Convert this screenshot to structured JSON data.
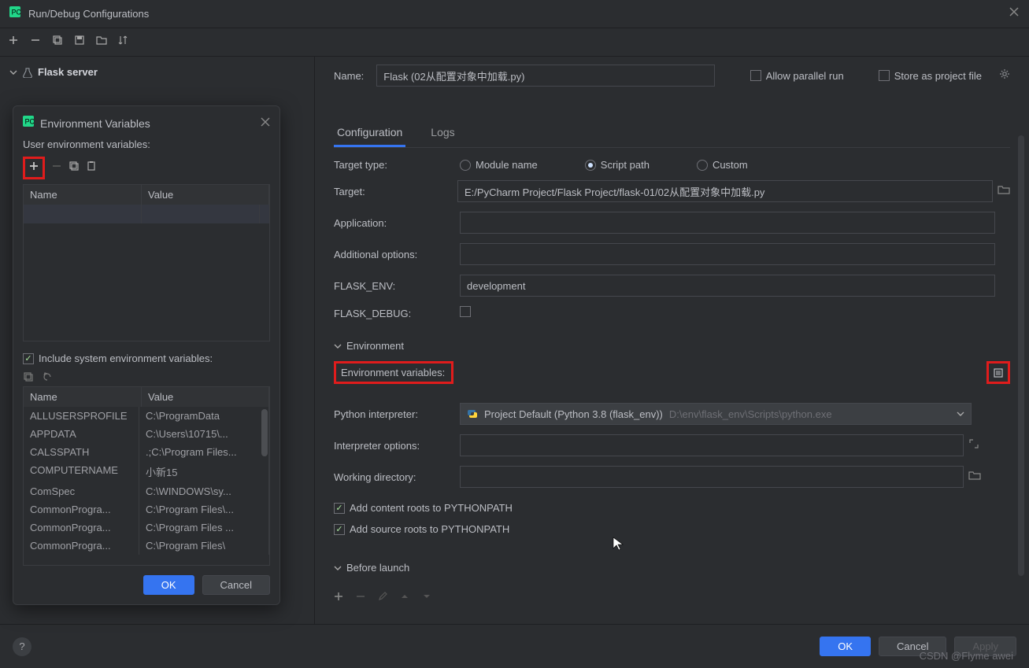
{
  "window": {
    "title": "Run/Debug Configurations"
  },
  "tree": {
    "rootLabel": "Flask server"
  },
  "name": {
    "label": "Name:",
    "value": "Flask (02从配置对象中加载.py)",
    "allowParallel": "Allow parallel run",
    "storeProject": "Store as project file"
  },
  "tabs": {
    "configuration": "Configuration",
    "logs": "Logs"
  },
  "targetType": {
    "label": "Target type:",
    "module": "Module name",
    "script": "Script path",
    "custom": "Custom"
  },
  "target": {
    "label": "Target:",
    "value": "E:/PyCharm Project/Flask Project/flask-01/02从配置对象中加载.py"
  },
  "application": {
    "label": "Application:"
  },
  "additional": {
    "label": "Additional options:"
  },
  "flaskEnv": {
    "label": "FLASK_ENV:",
    "value": "development"
  },
  "flaskDebug": {
    "label": "FLASK_DEBUG:"
  },
  "envSection": "Environment",
  "envVars": {
    "label": "Environment variables:"
  },
  "interpreter": {
    "label": "Python interpreter:",
    "value": "Project Default (Python 3.8 (flask_env))",
    "path": "D:\\env\\flask_env\\Scripts\\python.exe"
  },
  "interpOptions": {
    "label": "Interpreter options:"
  },
  "workDir": {
    "label": "Working directory:"
  },
  "contentRoots": "Add content roots to PYTHONPATH",
  "sourceRoots": "Add source roots to PYTHONPATH",
  "beforeLaunch": "Before launch",
  "envPopup": {
    "title": "Environment Variables",
    "userLabel": "User environment variables:",
    "nameCol": "Name",
    "valueCol": "Value",
    "includeSystem": "Include system environment variables:",
    "sysNameCol": "Name",
    "sysValueCol": "Value",
    "rows": [
      {
        "name": "ALLUSERSPROFILE",
        "value": "C:\\ProgramData"
      },
      {
        "name": "APPDATA",
        "value": "C:\\Users\\10715\\..."
      },
      {
        "name": "CALSSPATH",
        "value": ".;C:\\Program Files..."
      },
      {
        "name": "COMPUTERNAME",
        "value": "小新15"
      },
      {
        "name": "ComSpec",
        "value": "C:\\WINDOWS\\sy..."
      },
      {
        "name": "CommonProgra...",
        "value": "C:\\Program Files\\..."
      },
      {
        "name": "CommonProgra...",
        "value": "C:\\Program Files ..."
      },
      {
        "name": "CommonProgra...",
        "value": "C:\\Program Files\\"
      }
    ],
    "ok": "OK",
    "cancel": "Cancel"
  },
  "footer": {
    "ok": "OK",
    "cancel": "Cancel",
    "apply": "Apply"
  },
  "watermark": "CSDN @Flyme awei"
}
